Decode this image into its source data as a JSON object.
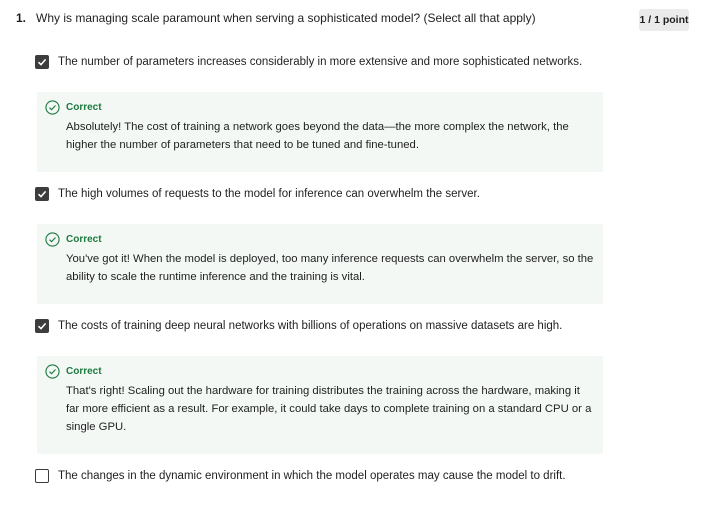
{
  "question": {
    "number": "1.",
    "text": "Why is managing scale paramount when serving a sophisticated model? (Select all that apply)",
    "score": "1 / 1 point"
  },
  "options": [
    {
      "label": "The number of parameters increases considerably in more extensive and more sophisticated networks.",
      "checked": true,
      "feedback": {
        "status": "Correct",
        "text": "Absolutely! The cost of training a network goes beyond the data—the more complex the network, the higher the number of parameters that need to be tuned and fine-tuned."
      }
    },
    {
      "label": "The high volumes of requests to the model for inference can overwhelm the server.",
      "checked": true,
      "feedback": {
        "status": "Correct",
        "text": "You've got it! When the model is deployed, too many inference requests can overwhelm the server, so the ability to scale the runtime inference and the training is vital."
      }
    },
    {
      "label": "The costs of training deep neural networks with billions of operations on massive datasets are high.",
      "checked": true,
      "feedback": {
        "status": "Correct",
        "text": "That's right! Scaling out the hardware for training distributes the training across the hardware, making it far more efficient as a result. For example, it could take days to complete training on a standard CPU or a single GPU."
      }
    },
    {
      "label": "The changes in the dynamic environment in which the model operates may cause the model to drift.",
      "checked": false
    }
  ],
  "colors": {
    "correct_green": "#1d7a3f",
    "feedback_bg": "#f3f8f5",
    "checkbox_dark": "#3d3d3d"
  },
  "icons": {
    "checked": "checkmark-icon",
    "feedback": "check-circle-icon"
  }
}
